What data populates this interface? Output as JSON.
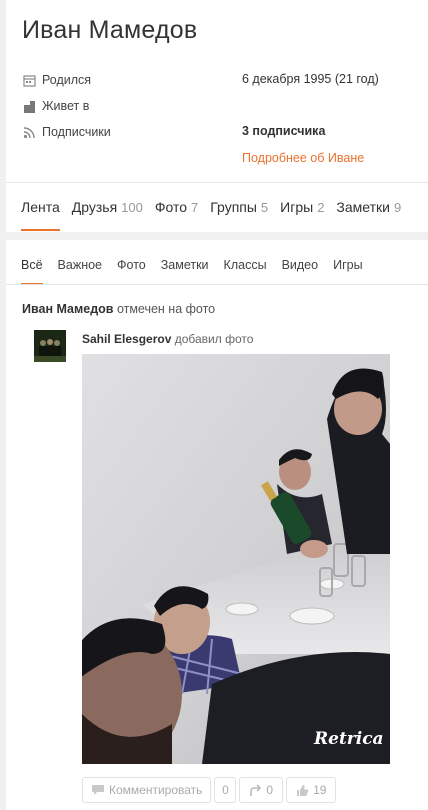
{
  "profile": {
    "name": "Иван Мамедов",
    "birth_label": "Родился",
    "birth_value": "6 декабря 1995 (21 год)",
    "lives_label": "Живет в",
    "subscribers_label": "Подписчики",
    "subscribers_value": "3 подписчика",
    "more_link": "Подробнее об Иване"
  },
  "main_tabs": [
    {
      "label": "Лента",
      "count": ""
    },
    {
      "label": "Друзья",
      "count": "100"
    },
    {
      "label": "Фото",
      "count": "7"
    },
    {
      "label": "Группы",
      "count": "5"
    },
    {
      "label": "Игры",
      "count": "2"
    },
    {
      "label": "Заметки",
      "count": "9"
    }
  ],
  "sub_tabs": [
    "Всё",
    "Важное",
    "Фото",
    "Заметки",
    "Классы",
    "Видео",
    "Игры"
  ],
  "feed": {
    "header_name": "Иван Мамедов",
    "header_action": "отмечен на фото",
    "author_name": "Sahil Elesgerov",
    "author_action": "добавил фото",
    "watermark": "Retrica"
  },
  "actions": {
    "comment_label": "Комментировать",
    "comment_count": "0",
    "share_count": "0",
    "like_count": "19"
  },
  "colors": {
    "accent": "#eb722e",
    "background": "#f0f0f0"
  }
}
